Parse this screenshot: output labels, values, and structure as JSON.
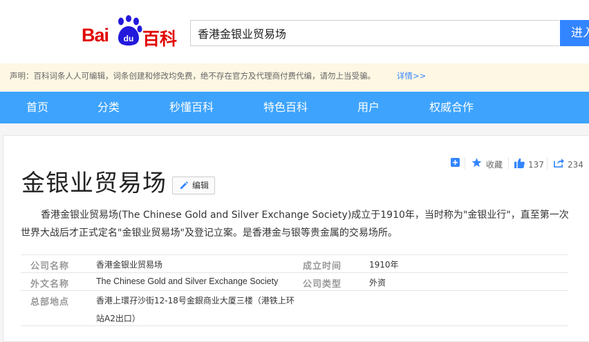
{
  "header": {
    "logo": {
      "bai": "Bai",
      "du": "du",
      "baike": "百科"
    },
    "search": {
      "value": "香港金银业贸易场"
    },
    "enter_button": "进入"
  },
  "notice": {
    "text": "声明：百科词条人人可编辑，词条创建和修改均免费，绝不存在官方及代理商付费代编，请勿上当受骗。",
    "more": "详情>>"
  },
  "nav": {
    "items": [
      {
        "label": "首页"
      },
      {
        "label": "分类"
      },
      {
        "label": "秒懂百科"
      },
      {
        "label": "特色百科"
      },
      {
        "label": "用户"
      },
      {
        "label": "权威合作"
      }
    ]
  },
  "tools": {
    "collect": "收藏",
    "likes": "137",
    "shares": "234",
    "icons": [
      "add-icon",
      "star-icon",
      "thumbs-up-icon",
      "share-icon"
    ]
  },
  "article": {
    "title": "金银业贸易场",
    "edit_label": "编辑",
    "summary": "香港金银业贸易场(The Chinese Gold and Silver Exchange Society)成立于1910年，当时称为\"金银业行\"，直至第一次世界大战后才正式定名\"金银业贸易场\"及登记立案。是香港金与银等贵金属的交易场所。"
  },
  "info": {
    "company_name_label": "公司名称",
    "company_name": "香港金银业贸易场",
    "founded_label": "成立时间",
    "founded": "1910年",
    "foreign_name_label": "外文名称",
    "foreign_name": "The Chinese Gold and Silver Exchange Society",
    "company_type_label": "公司类型",
    "company_type": "外资",
    "hq_label": "总部地点",
    "hq_line1": "香港上環孖沙街12-18号金銀商业大厦三楼（港铁上环",
    "hq_line2": "站A2出口）"
  },
  "colors": {
    "brand_red": "#e10602",
    "baidu_blue": "#2319dc",
    "nav_blue": "#3da3fd",
    "button_blue": "#3385ff",
    "notice_bg": "#fdf7e3",
    "link_blue": "#3385ff"
  }
}
